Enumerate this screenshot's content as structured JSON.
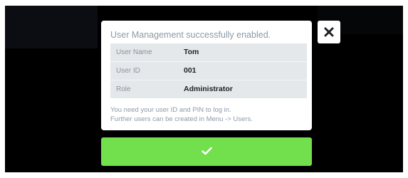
{
  "dialog": {
    "title": "User Management successfully enabled.",
    "rows": [
      {
        "label": "User Name",
        "value": "Tom"
      },
      {
        "label": "User ID",
        "value": "001"
      },
      {
        "label": "Role",
        "value": "Administrator"
      }
    ],
    "note_line1": "You need your user ID and PIN to log in.",
    "note_line2": "Further users can be created in Menu -> Users."
  },
  "buttons": {
    "close_icon": "close-icon",
    "confirm_icon": "checkmark-icon"
  },
  "colors": {
    "background": "#000000",
    "dialog": "#ffffff",
    "table": "#e4e8ea",
    "accent_green": "#72e04d",
    "muted_text": "#8d9aa6"
  }
}
